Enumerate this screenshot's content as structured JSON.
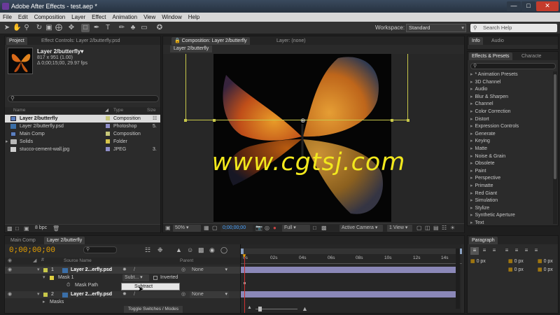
{
  "app": {
    "title": "Adobe After Effects - test.aep *",
    "tabs_faint": [
      "Adobe",
      "Edit",
      "View",
      "Window",
      "Help"
    ]
  },
  "menu": [
    "File",
    "Edit",
    "Composition",
    "Layer",
    "Effect",
    "Animation",
    "View",
    "Window",
    "Help"
  ],
  "toolbar": {
    "workspace_label": "Workspace:",
    "workspace_value": "Standard",
    "search_placeholder": "Search Help"
  },
  "project": {
    "tab": "Project",
    "tab2": "Effect Controls: Layer 2/butterfly.psd",
    "selected_name": "Layer 2/butterfly▾",
    "selected_info1": "817 x 951 (1.00)",
    "selected_info2": "Δ 0;00;15;00, 29.97 fps",
    "search_placeholder": "",
    "columns": {
      "name": "Name",
      "type": "Type",
      "size": "Size"
    },
    "items": [
      {
        "name": "Layer 2/butterfly",
        "type": "Composition",
        "size": "",
        "color": "#c8c87a",
        "selected": true
      },
      {
        "name": "Layer 2/butterfly.psd",
        "type": "Photoshop",
        "size": "5.",
        "color": "#8e8ec8",
        "selected": false
      },
      {
        "name": "Main Comp",
        "type": "Composition",
        "size": "",
        "color": "#c8c87a",
        "selected": false
      },
      {
        "name": "Solids",
        "type": "Folder",
        "size": "",
        "color": "#d6c44a",
        "selected": false
      },
      {
        "name": "stucco-cement-wall.jpg",
        "type": "JPEG",
        "size": "3.",
        "color": "#8e8ec8",
        "selected": false
      }
    ],
    "bpc": "8 bpc"
  },
  "comp": {
    "tab": "Composition: Layer 2/butterfly",
    "tab2": "Layer: (none)",
    "subtab": "Layer 2/butterfly",
    "zoom": "50%",
    "timecode": "0;00;00;00",
    "resolution": "Full",
    "camera": "Active Camera",
    "views": "1 View",
    "watermark": "www.cgtsj.com"
  },
  "info_panel": {
    "tabs": [
      "Info",
      "Audio"
    ]
  },
  "effects": {
    "tabs": [
      "Effects & Presets",
      "Characte"
    ],
    "search_placeholder": "",
    "items": [
      "* Animation Presets",
      "3D Channel",
      "Audio",
      "Blur & Sharpen",
      "Channel",
      "Color Correction",
      "Distort",
      "Expression Controls",
      "Generate",
      "Keying",
      "Matte",
      "Noise & Grain",
      "Obsolete",
      "Paint",
      "Perspective",
      "Primatte",
      "Red Giant",
      "Simulation",
      "Stylize",
      "Synthetic Aperture",
      "Text"
    ]
  },
  "paragraph": {
    "tab": "Paragraph",
    "fields": [
      "0 px",
      "0 px",
      "0 px",
      "0 px",
      "0 px"
    ]
  },
  "timeline": {
    "tabs": [
      "Main Comp",
      "Layer 2/butterfly"
    ],
    "timecode": "0;00;00;00",
    "col_source": "Source Name",
    "col_parent": "Parent",
    "ruler": [
      "0s",
      "02s",
      "04s",
      "06s",
      "08s",
      "10s",
      "12s",
      "14s"
    ],
    "layers": [
      {
        "num": "1",
        "name": "Layer 2...erfly.psd",
        "parent": "None",
        "color": "#c8c84a"
      },
      {
        "num": "2",
        "name": "Layer 2...erfly.psd",
        "parent": "None",
        "color": "#c8c84a"
      }
    ],
    "mask": {
      "label": "Mask 1",
      "mode": "Subt...",
      "inverted": "Inverted",
      "path": "Mask Path",
      "dropdown": "Subtract"
    },
    "masks_label": "Masks",
    "toggle": "Toggle Switches / Modes"
  }
}
